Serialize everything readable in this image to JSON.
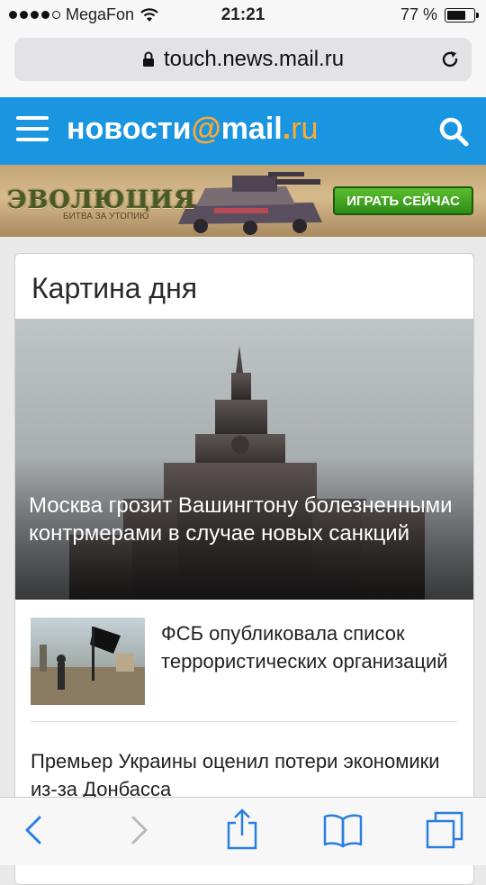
{
  "status_bar": {
    "carrier": "MegaFon",
    "time": "21:21",
    "battery_text": "77 %",
    "battery_level": 0.77,
    "signal_bars": 4,
    "signal_max": 5
  },
  "browser": {
    "url": "touch.news.mail.ru"
  },
  "header": {
    "logo_part1": "новости",
    "logo_at": "@",
    "logo_part2": "mail",
    "logo_dot": ".",
    "logo_ru": "ru",
    "menu_icon": "hamburger-icon",
    "search_icon": "search-icon",
    "brand_color": "#1a96e0",
    "accent_color": "#ffa930"
  },
  "banner": {
    "title": "ЭВОЛЮЦИЯ",
    "subtitle": "БИТВА ЗА УТОПИЮ",
    "cta": "ИГРАТЬ СЕЙЧАС"
  },
  "card": {
    "title": "Картина дня",
    "hero_headline": "Москва грозит Вашингтону болезненными контрмерами в случае новых санкций",
    "items": [
      {
        "text": "ФСБ опубликовала список террористических организаций"
      },
      {
        "text": "Премьер Украины оценил потери экономики из-за Донбасса"
      }
    ]
  },
  "toolbar": {
    "icons": [
      "back-icon",
      "forward-icon",
      "share-icon",
      "bookmarks-icon",
      "tabs-icon"
    ],
    "active_color": "#2a7ee0",
    "disabled_color": "#b9b9b9"
  }
}
